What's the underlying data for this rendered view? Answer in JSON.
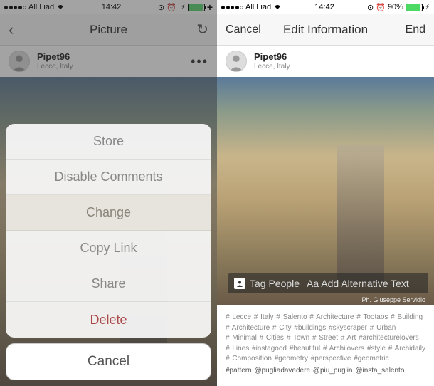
{
  "statusbar": {
    "carrier": "All Liad",
    "time": "14:42",
    "battery_left_pct": 90,
    "battery_right_pct": 90,
    "battery_right_text": "90%"
  },
  "left": {
    "nav": {
      "title": "Picture"
    },
    "user": {
      "name": "Pipet96",
      "location": "Lecce, Italy"
    },
    "action_sheet": {
      "items": [
        {
          "label": "Store",
          "kind": "normal"
        },
        {
          "label": "Disable Comments",
          "kind": "normal"
        },
        {
          "label": "Change",
          "kind": "highlight"
        },
        {
          "label": "Copy Link",
          "kind": "normal"
        },
        {
          "label": "Share",
          "kind": "normal"
        },
        {
          "label": "Delete",
          "kind": "danger"
        }
      ],
      "cancel": "Cancel"
    }
  },
  "right": {
    "nav": {
      "left": "Cancel",
      "title": "Edit Information",
      "right": "End"
    },
    "user": {
      "name": "Pipet96",
      "location": "Lecce, Italy"
    },
    "tag_overlay": {
      "tag_people": "Tag People",
      "add_alt": "Aa Add Alternative Text"
    },
    "credit": "Ph. Giuseppe Servidio",
    "caption_lines": [
      "# Lecce # Italy # Salento # Architecture # Tootaos # Building",
      "# Architecture # City #buildings #skyscraper # Urban",
      "# Minimal # Cities # Town # Street # Art #architecturelovers",
      "# Lines #instagood #beautiful # Archilovers #style # Archidaily",
      "# Composition #geometry #perspective #geometric"
    ],
    "caption_bold": "#pattern @pugliadavedere @piu_puglia @insta_salento"
  }
}
